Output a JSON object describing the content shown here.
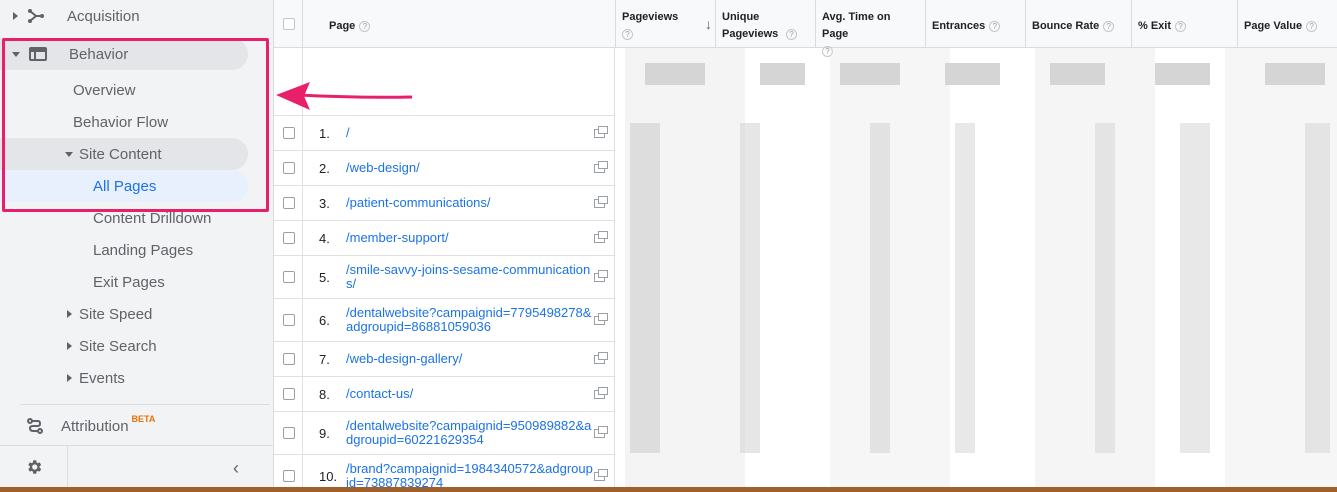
{
  "sidebar": {
    "items": [
      {
        "label": "Acquisition"
      },
      {
        "label": "Behavior"
      },
      {
        "label": "Overview"
      },
      {
        "label": "Behavior Flow"
      },
      {
        "label": "Site Content"
      },
      {
        "label": "All Pages"
      },
      {
        "label": "Content Drilldown"
      },
      {
        "label": "Landing Pages"
      },
      {
        "label": "Exit Pages"
      },
      {
        "label": "Site Speed"
      },
      {
        "label": "Site Search"
      },
      {
        "label": "Events"
      },
      {
        "label": "Attribution"
      }
    ],
    "beta_badge": "BETA"
  },
  "table": {
    "columns": [
      {
        "label": "Page"
      },
      {
        "label": "Pageviews"
      },
      {
        "label": "Unique Pageviews"
      },
      {
        "label": "Avg. Time on Page"
      },
      {
        "label": "Entrances"
      },
      {
        "label": "Bounce Rate"
      },
      {
        "label": "% Exit"
      },
      {
        "label": "Page Value"
      }
    ],
    "help_glyph": "?",
    "sort_glyph": "↓",
    "rows": [
      {
        "idx": "1.",
        "page": "/"
      },
      {
        "idx": "2.",
        "page": "/web-design/"
      },
      {
        "idx": "3.",
        "page": "/patient-communications/"
      },
      {
        "idx": "4.",
        "page": "/member-support/"
      },
      {
        "idx": "5.",
        "page": "/smile-savvy-joins-sesame-communications/"
      },
      {
        "idx": "6.",
        "page": "/dentalwebsite?campaignid=7795498278&adgroupid=86881059036"
      },
      {
        "idx": "7.",
        "page": "/web-design-gallery/"
      },
      {
        "idx": "8.",
        "page": "/contact-us/"
      },
      {
        "idx": "9.",
        "page": "/dentalwebsite?campaignid=950989882&adgroupid=60221629354"
      },
      {
        "idx": "10.",
        "page": "/brand?campaignid=1984340572&adgroupid=73887839274"
      }
    ]
  },
  "icons": {
    "acquisition": "acquisition-icon",
    "behavior": "behavior-icon",
    "attribution": "attribution-icon",
    "settings": "gear-icon",
    "collapse": "chevron-left-icon",
    "external": "open-external-icon"
  },
  "colors": {
    "link": "#1a73e8",
    "highlight": "#e8206b",
    "selected_bg": "#e8f0fe"
  }
}
